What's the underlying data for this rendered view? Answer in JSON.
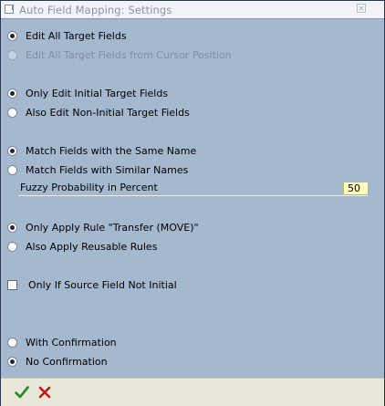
{
  "window": {
    "title": "Auto Field Mapping: Settings",
    "close_icon": "close-icon"
  },
  "edit_mode": {
    "options": [
      {
        "label": "Edit All Target Fields",
        "selected": true,
        "enabled": true
      },
      {
        "label": "Edit All Target Fields from Cursor Position",
        "selected": false,
        "enabled": false
      }
    ]
  },
  "initial_fields": {
    "options": [
      {
        "label": "Only Edit Initial Target Fields",
        "selected": true
      },
      {
        "label": "Also Edit Non-Initial Target Fields",
        "selected": false
      }
    ]
  },
  "matching": {
    "options": [
      {
        "label": "Match Fields with the Same Name",
        "selected": true
      },
      {
        "label": "Match Fields with Similar Names",
        "selected": false
      }
    ],
    "fuzzy_label": "Fuzzy Probability in Percent",
    "fuzzy_value": "50"
  },
  "rules": {
    "options": [
      {
        "label": "Only Apply Rule \"Transfer (MOVE)\"",
        "selected": true
      },
      {
        "label": "Also Apply Reusable Rules",
        "selected": false
      }
    ]
  },
  "source_check": {
    "label": "Only If Source Field Not Initial",
    "checked": false
  },
  "confirmation": {
    "options": [
      {
        "label": "With Confirmation",
        "selected": false
      },
      {
        "label": "No Confirmation",
        "selected": true
      }
    ]
  },
  "toolbar": {
    "ok_icon": "checkmark-icon",
    "cancel_icon": "cancel-x-icon",
    "colors": {
      "ok": "#1f8a1f",
      "cancel": "#c41a1a"
    }
  }
}
